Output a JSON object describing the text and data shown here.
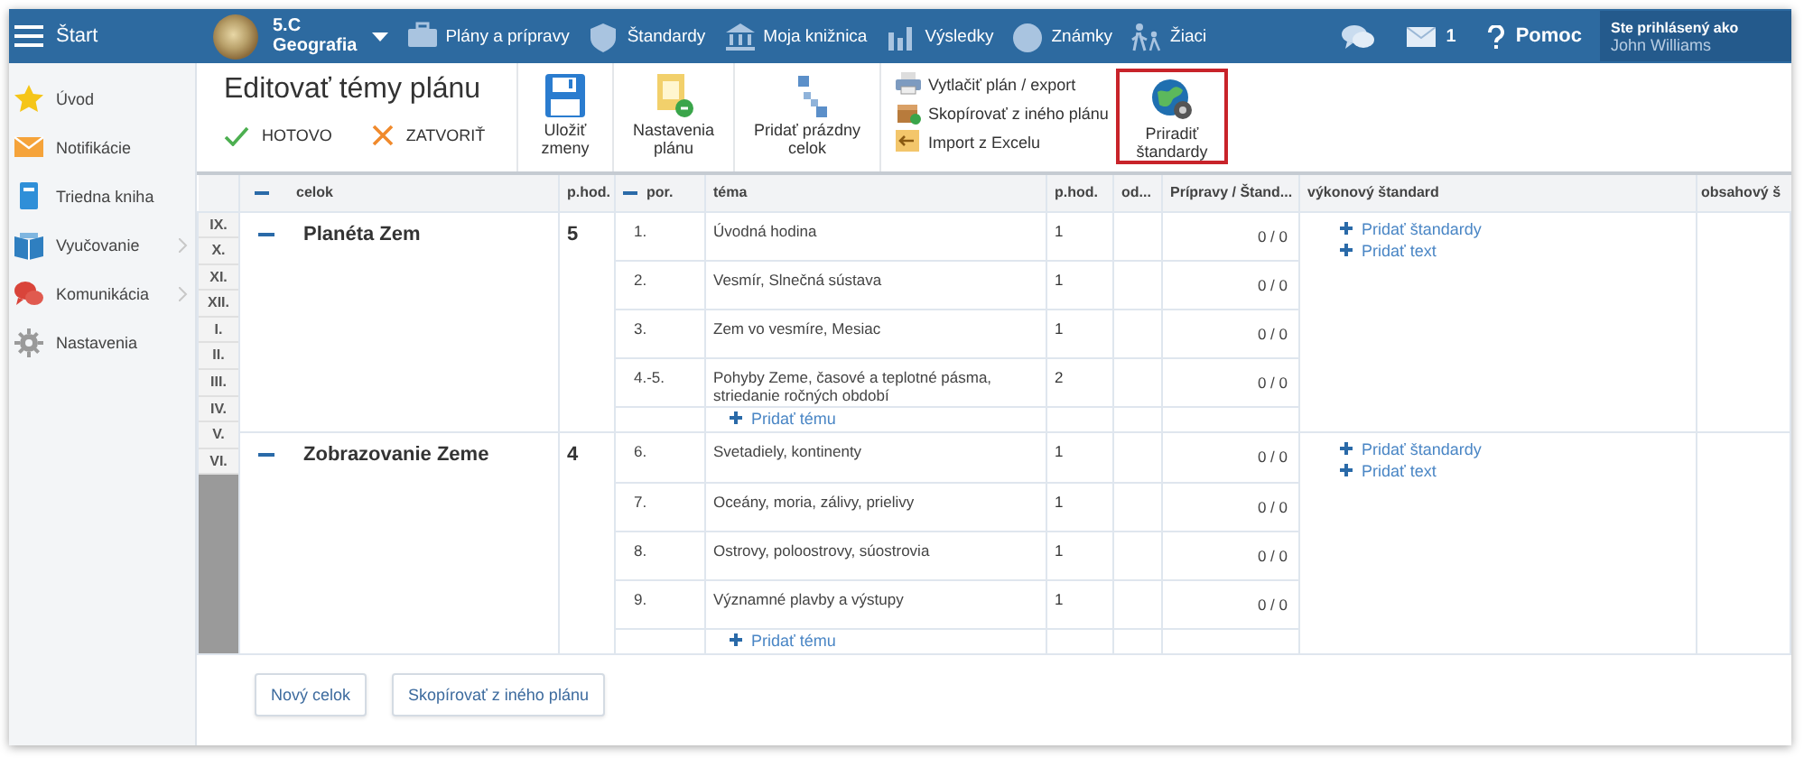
{
  "topbar": {
    "menu_label": "Štart",
    "class_name": "5.C",
    "subject": "Geografia",
    "nav": [
      {
        "label": "Plány a prípravy"
      },
      {
        "label": "Štandardy"
      },
      {
        "label": "Moja knižnica"
      },
      {
        "label": "Výsledky"
      },
      {
        "label": "Známky"
      },
      {
        "label": "Žiaci"
      }
    ],
    "messages_count": "1",
    "help": "Pomoc",
    "user_label": "Ste prihlásený ako",
    "user_name": "John Williams"
  },
  "sidebar": {
    "items": [
      {
        "label": "Úvod",
        "has_submenu": false
      },
      {
        "label": "Notifikácie",
        "has_submenu": false
      },
      {
        "label": "Triedna kniha",
        "has_submenu": false
      },
      {
        "label": "Vyučovanie",
        "has_submenu": true
      },
      {
        "label": "Komunikácia",
        "has_submenu": true
      },
      {
        "label": "Nastavenia",
        "has_submenu": false
      }
    ]
  },
  "toolbar": {
    "title": "Editovať témy plánu",
    "done": "HOTOVO",
    "close": "ZATVORIŤ",
    "buttons": [
      {
        "label": "Uložiť zmeny"
      },
      {
        "label": "Nastavenia plánu"
      },
      {
        "label": "Pridať prázdny celok"
      }
    ],
    "links": [
      {
        "label": "Vytlačiť plán / export"
      },
      {
        "label": "Skopírovať z iného plánu"
      },
      {
        "label": "Import z Excelu"
      }
    ],
    "assign": {
      "label": "Priradiť štandardy",
      "highlighted": true
    }
  },
  "table": {
    "columns": [
      "celok",
      "p.hod.",
      "por.",
      "téma",
      "p.hod.",
      "od...",
      "Prípravy / Štand...",
      "výkonový štandard",
      "obsahový š"
    ],
    "months": [
      "IX.",
      "X.",
      "XI.",
      "XII.",
      "I.",
      "II.",
      "III.",
      "IV.",
      "V.",
      "VI."
    ],
    "units": [
      {
        "name": "Planéta Zem",
        "hours": "5",
        "expanded": true,
        "add_topic": "Pridať tému",
        "standard_links": [
          "Pridať štandardy",
          "Pridať text"
        ],
        "topics": [
          {
            "order": "1.",
            "theme": "Úvodná hodina",
            "hours": "1",
            "preparations": "0 / 0"
          },
          {
            "order": "2.",
            "theme": "Vesmír, Slnečná sústava",
            "hours": "1",
            "preparations": "0 / 0"
          },
          {
            "order": "3.",
            "theme": "Zem vo vesmíre, Mesiac",
            "hours": "1",
            "preparations": "0 / 0"
          },
          {
            "order": "4.-5.",
            "theme": "Pohyby Zeme, časové a teplotné pásma, striedanie ročných období",
            "hours": "2",
            "preparations": "0 / 0"
          }
        ]
      },
      {
        "name": "Zobrazovanie Zeme",
        "hours": "4",
        "expanded": true,
        "add_topic": "Pridať tému",
        "standard_links": [
          "Pridať štandardy",
          "Pridať text"
        ],
        "topics": [
          {
            "order": "6.",
            "theme": "Svetadiely, kontinenty",
            "hours": "1",
            "preparations": "0 / 0"
          },
          {
            "order": "7.",
            "theme": "Oceány, moria, zálivy, prielivy",
            "hours": "1",
            "preparations": "0 / 0"
          },
          {
            "order": "8.",
            "theme": "Ostrovy, poloostrovy, súostrovia",
            "hours": "1",
            "preparations": "0 / 0"
          },
          {
            "order": "9.",
            "theme": "Významné plavby a výstupy",
            "hours": "1",
            "preparations": "0 / 0"
          }
        ]
      }
    ]
  },
  "buttons": [
    "Nový celok",
    "Skopírovať z iného plánu"
  ]
}
